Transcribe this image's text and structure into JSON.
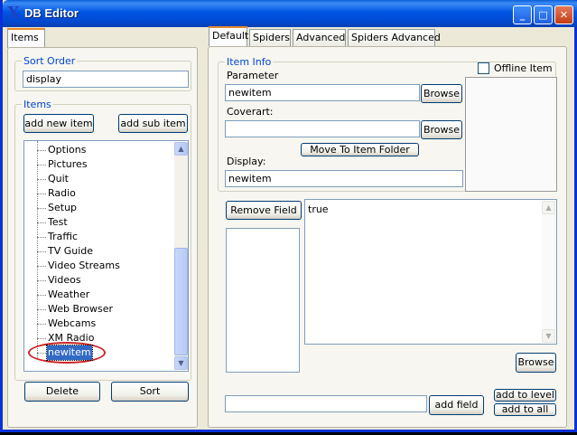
{
  "window": {
    "title": "DB Editor",
    "icon": "X"
  },
  "left": {
    "tab": "Items",
    "sort_order": {
      "title": "Sort Order",
      "value": "display"
    },
    "items": {
      "title": "Items",
      "add_new_item": "add new item",
      "add_sub_item": "add sub item",
      "list": [
        "Options",
        "Pictures",
        "Quit",
        "Radio",
        "Setup",
        "Test",
        "Traffic",
        "TV Guide",
        "Video Streams",
        "Videos",
        "Weather",
        "Web Browser",
        "Webcams",
        "XM Radio",
        "newitem"
      ],
      "selected": "newitem"
    },
    "delete_label": "Delete",
    "sort_label": "Sort"
  },
  "right": {
    "tabs": [
      "Default",
      "Spiders",
      "Advanced",
      "Spiders Advanced"
    ],
    "active_tab": "Default",
    "item_info": {
      "title": "Item Info",
      "parameter_label": "Parameter",
      "parameter_value": "newitem",
      "browse_label": "Browse",
      "coverart_label": "Coverart:",
      "coverart_value": "",
      "move_label": "Move To Item Folder",
      "display_label": "Display:",
      "display_value": "newitem",
      "offline_label": "Offline Item",
      "offline_checked": false
    },
    "fields": {
      "remove_label": "Remove Field",
      "value_text": "true",
      "browse_label": "Browse",
      "new_field_value": "",
      "add_field_label": "add field",
      "add_to_level_label": "add to level",
      "add_to_all_label": "add to all"
    }
  },
  "colors": {
    "titlebar": "#0054e3",
    "selection": "#316ac5",
    "highlight_circle": "#cc2222",
    "group_title": "#0046d5"
  }
}
